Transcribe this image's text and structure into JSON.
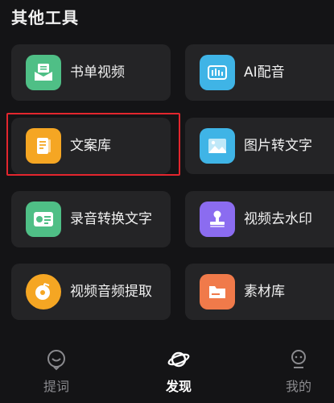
{
  "section": {
    "title": "其他工具"
  },
  "tools": [
    {
      "label": "书单视频",
      "icon": "book-video-icon",
      "color": "#4fbf86"
    },
    {
      "label": "AI配音",
      "icon": "ai-voice-icon",
      "color": "#3fb4e6"
    },
    {
      "label": "文案库",
      "icon": "copywriting-icon",
      "color": "#f5a623"
    },
    {
      "label": "图片转文字",
      "icon": "image-to-text-icon",
      "color": "#3fb4e6"
    },
    {
      "label": "录音转换文字",
      "icon": "audio-to-text-icon",
      "color": "#4fbf86"
    },
    {
      "label": "视频去水印",
      "icon": "remove-watermark-icon",
      "color": "#8b6cf0"
    },
    {
      "label": "视频音频提取",
      "icon": "audio-extract-icon",
      "color": "#f5a623"
    },
    {
      "label": "素材库",
      "icon": "material-library-icon",
      "color": "#f07a4a"
    }
  ],
  "highlight_color": "#e3262e",
  "tabs": [
    {
      "label": "提词",
      "icon": "prompt-icon",
      "active": false
    },
    {
      "label": "发现",
      "icon": "planet-icon",
      "active": true
    },
    {
      "label": "我的",
      "icon": "profile-icon",
      "active": false
    }
  ]
}
